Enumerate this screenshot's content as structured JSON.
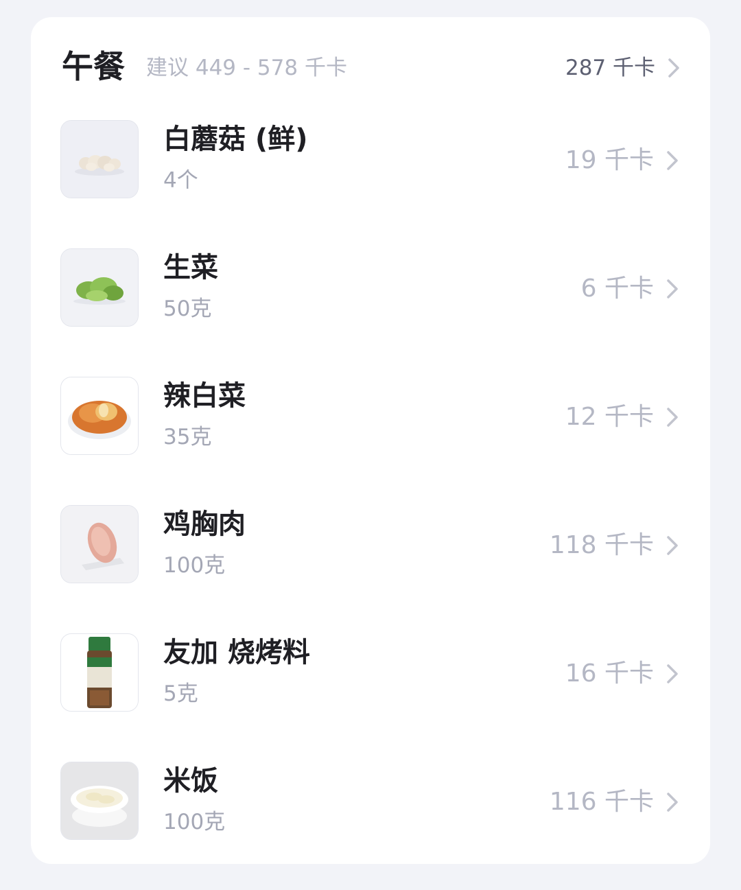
{
  "meal": {
    "title": "午餐",
    "suggestion": "建议 449 - 578 千卡",
    "total": "287 千卡"
  },
  "items": [
    {
      "name": "白蘑菇 (鲜)",
      "amount": "4个",
      "kcal": "19 千卡",
      "icon": "mushroom-photo"
    },
    {
      "name": "生菜",
      "amount": "50克",
      "kcal": "6 千卡",
      "icon": "lettuce-photo"
    },
    {
      "name": "辣白菜",
      "amount": "35克",
      "kcal": "12 千卡",
      "icon": "kimchi-photo"
    },
    {
      "name": "鸡胸肉",
      "amount": "100克",
      "kcal": "118 千卡",
      "icon": "chicken-breast-photo"
    },
    {
      "name": "友加 烧烤料",
      "amount": "5克",
      "kcal": "16 千卡",
      "icon": "seasoning-bottle-photo"
    },
    {
      "name": "米饭",
      "amount": "100克",
      "kcal": "116 千卡",
      "icon": "rice-bowl-photo"
    }
  ],
  "colors": {
    "background": "#f2f3f8",
    "card": "#ffffff",
    "title": "#1f1f24",
    "muted": "#b4b7c4",
    "total": "#5d6072"
  }
}
